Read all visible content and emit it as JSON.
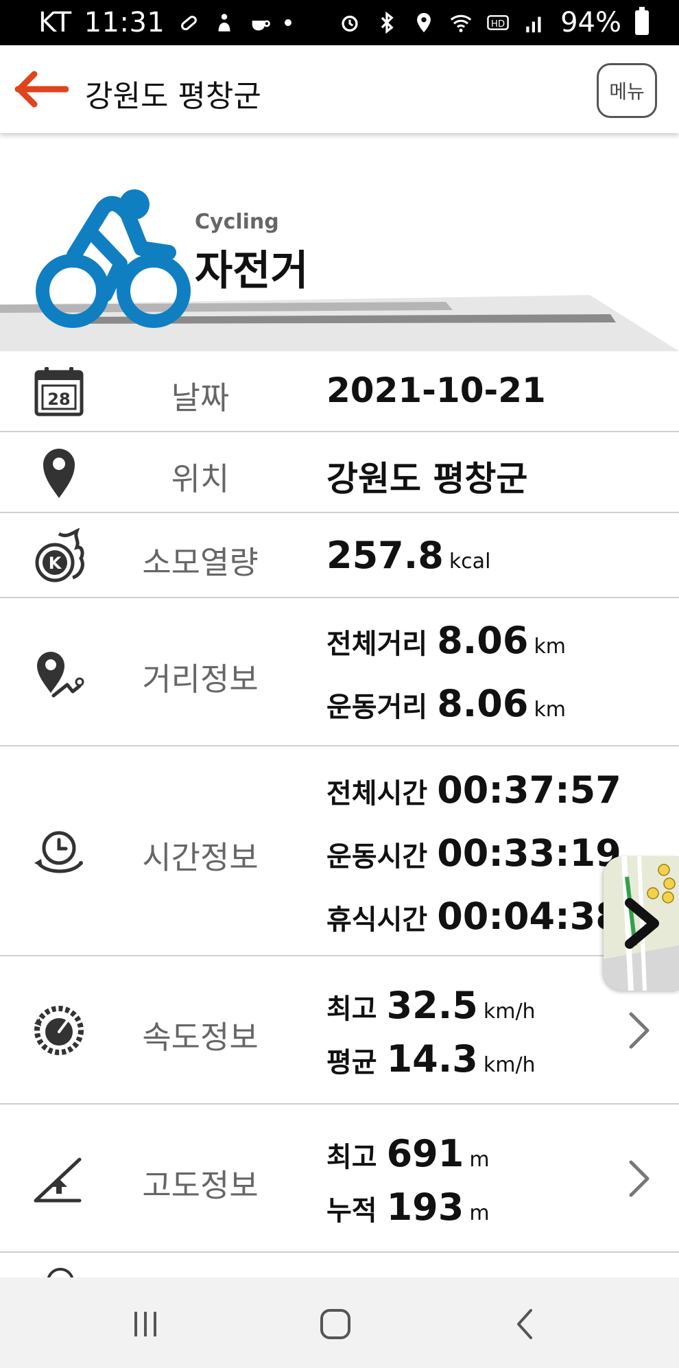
{
  "status_bar": {
    "carrier": "KT",
    "time": "11:31",
    "battery": "94%"
  },
  "header": {
    "title": "강원도 평창군",
    "menu_label": "메뉴"
  },
  "activity": {
    "name_en": "Cycling",
    "name_ko": "자전거",
    "calendar_day": "28"
  },
  "rows": {
    "date": {
      "label": "날짜",
      "value": "2021-10-21"
    },
    "location": {
      "label": "위치",
      "value": "강원도 평창군"
    },
    "calories": {
      "label": "소모열량",
      "value": "257.8",
      "unit": "kcal"
    },
    "distance": {
      "label": "거리정보",
      "total_label": "전체거리",
      "total_value": "8.06",
      "total_unit": "km",
      "moving_label": "운동거리",
      "moving_value": "8.06",
      "moving_unit": "km"
    },
    "time": {
      "label": "시간정보",
      "total_label": "전체시간",
      "total_value": "00:37:57",
      "moving_label": "운동시간",
      "moving_value": "00:33:19",
      "rest_label": "휴식시간",
      "rest_value": "00:04:38"
    },
    "speed": {
      "label": "속도정보",
      "max_label": "최고",
      "max_value": "32.5",
      "max_unit": "km/h",
      "avg_label": "평균",
      "avg_value": "14.3",
      "avg_unit": "km/h"
    },
    "altitude": {
      "label": "고도정보",
      "max_label": "최고",
      "max_value": "691",
      "max_unit": "m",
      "cum_label": "누적",
      "cum_value": "193",
      "cum_unit": "m"
    }
  },
  "colors": {
    "accent": "#e0441c",
    "cyclist_blue": "#0f7fc2",
    "label_gray": "#666666",
    "divider": "#cfcfcf"
  },
  "icons": {
    "back": "arrow-left-icon",
    "calendar": "calendar-icon",
    "location": "location-pin-icon",
    "calories": "calorie-flame-icon",
    "distance": "route-pin-icon",
    "time": "clock-icon",
    "speed": "speedometer-icon",
    "altitude": "altitude-icon"
  }
}
